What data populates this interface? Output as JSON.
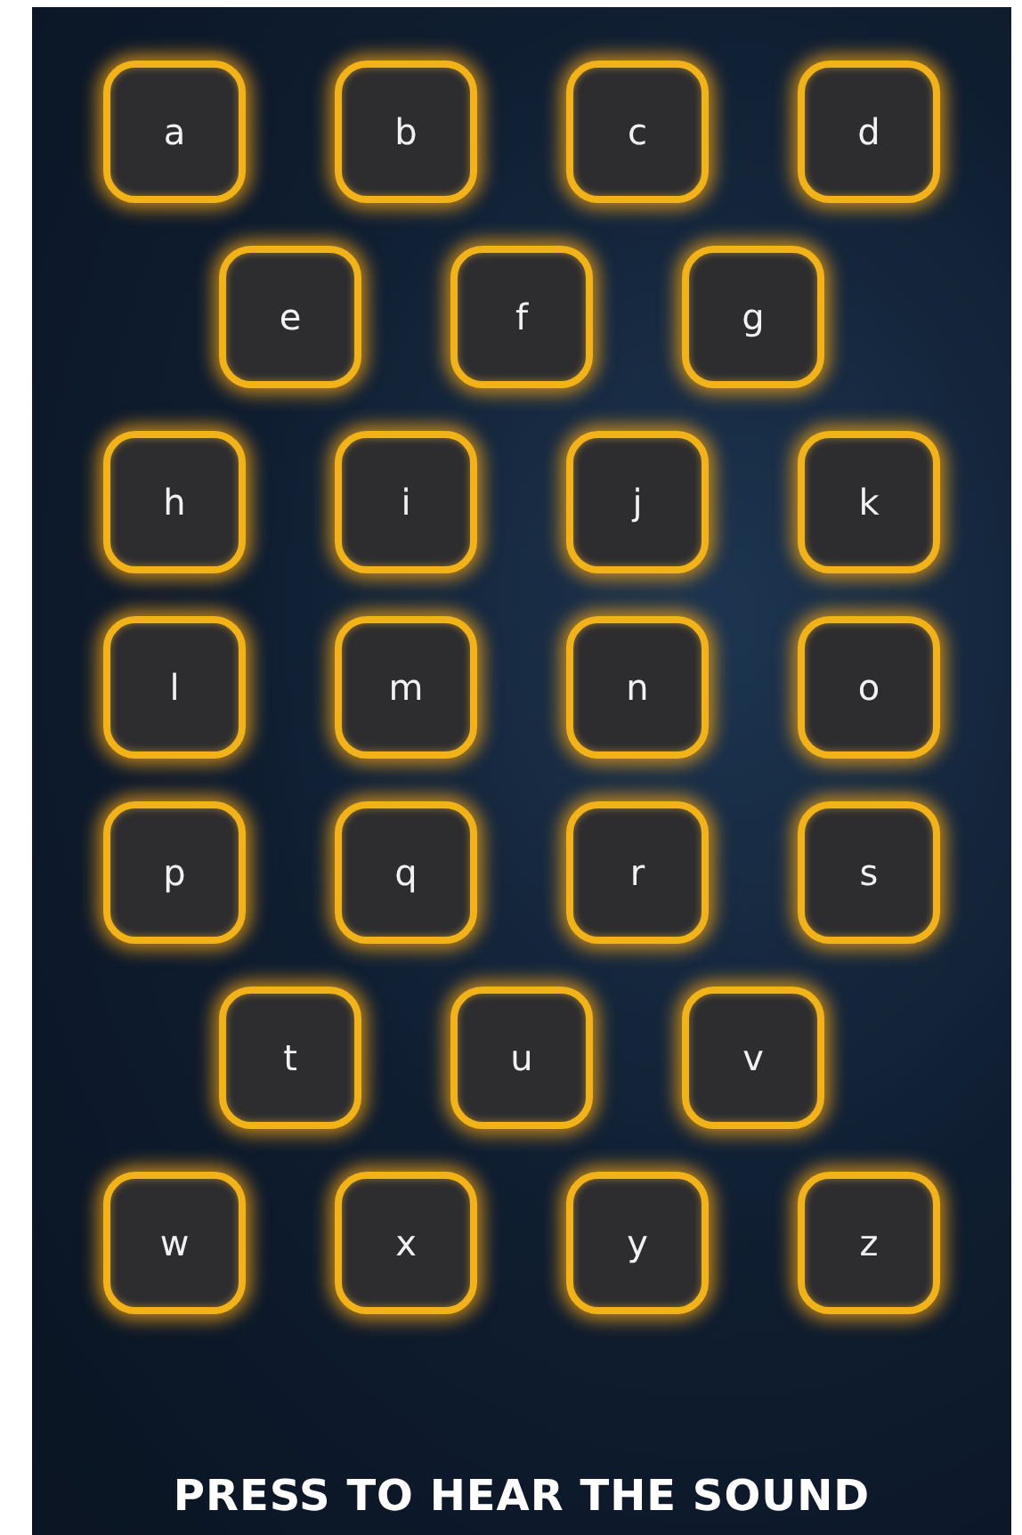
{
  "rows": [
    {
      "keys": [
        "a",
        "b",
        "c",
        "d"
      ]
    },
    {
      "keys": [
        "e",
        "f",
        "g"
      ]
    },
    {
      "keys": [
        "h",
        "i",
        "j",
        "k"
      ]
    },
    {
      "keys": [
        "l",
        "m",
        "n",
        "o"
      ]
    },
    {
      "keys": [
        "p",
        "q",
        "r",
        "s"
      ]
    },
    {
      "keys": [
        "t",
        "u",
        "v"
      ]
    },
    {
      "keys": [
        "w",
        "x",
        "y",
        "z"
      ]
    }
  ],
  "caption": "PRESS TO HEAR THE SOUND"
}
